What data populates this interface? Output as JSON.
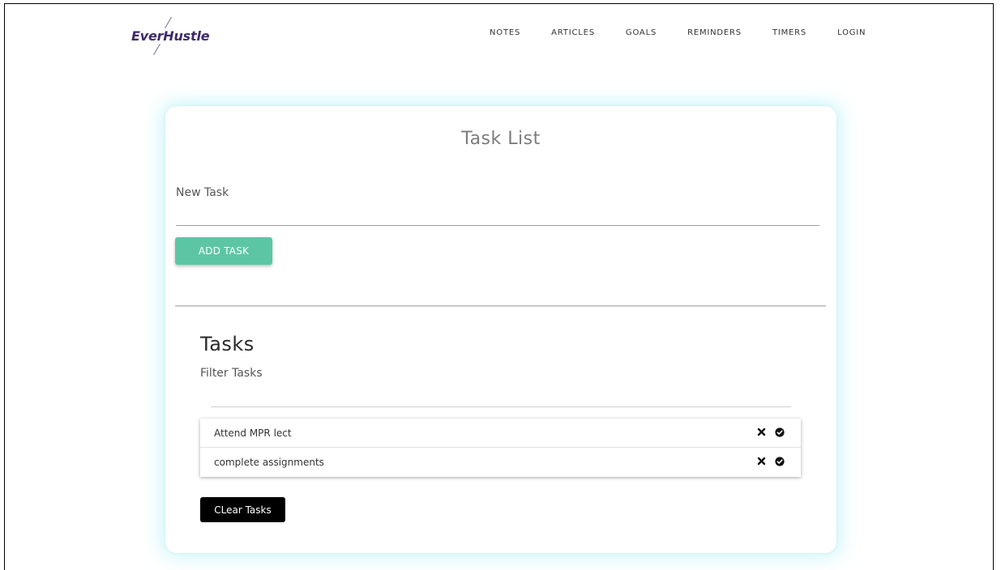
{
  "brand": {
    "logo_text": "EverHustle",
    "logo_color": "#3f2a6b"
  },
  "nav": {
    "items": [
      {
        "label": "NOTES"
      },
      {
        "label": "ARTICLES"
      },
      {
        "label": "GOALS"
      },
      {
        "label": "REMINDERS"
      },
      {
        "label": "TIMERS"
      },
      {
        "label": "LOGIN"
      }
    ]
  },
  "card": {
    "title": "Task List",
    "new_task": {
      "label": "New Task",
      "value": "",
      "placeholder": ""
    },
    "add_button_label": "ADD TASK",
    "tasks_heading": "Tasks",
    "filter": {
      "label": "Filter Tasks",
      "value": "",
      "placeholder": ""
    },
    "tasks": [
      {
        "text": "Attend MPR lect"
      },
      {
        "text": "complete assignments"
      }
    ],
    "clear_button_label": "CLear Tasks"
  },
  "icons": {
    "delete": "close-icon",
    "complete": "check-circle-icon"
  },
  "colors": {
    "add_button": "#5cc6a4",
    "clear_button": "#000000",
    "card_glow": "#aaeef8"
  }
}
